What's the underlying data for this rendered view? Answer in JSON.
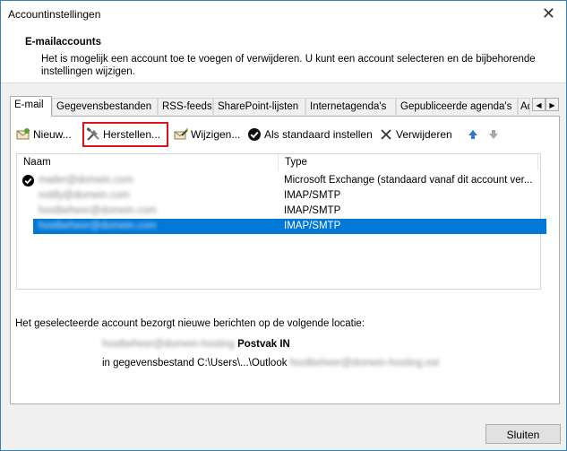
{
  "window": {
    "title": "Accountinstellingen",
    "close_glyph": "✕"
  },
  "header": {
    "title": "E-mailaccounts",
    "description": "Het is mogelijk een account toe te voegen of verwijderen. U kunt een account selecteren en de bijbehorende instellingen wijzigen."
  },
  "tabs": [
    "E-mail",
    "Gegevensbestanden",
    "RSS-feeds",
    "SharePoint-lijsten",
    "Internetagenda's",
    "Gepubliceerde agenda's",
    "Ad"
  ],
  "toolbar": {
    "new_label": "Nieuw...",
    "repair_label": "Herstellen...",
    "change_label": "Wijzigen...",
    "default_label": "Als standaard instellen",
    "remove_label": "Verwijderen"
  },
  "list": {
    "columns": [
      "Naam",
      "Type"
    ],
    "rows": [
      {
        "name": "mailer@domein.com",
        "type": "Microsoft Exchange (standaard vanaf dit account ver...",
        "default": true,
        "selected": false
      },
      {
        "name": "notify@domein.com",
        "type": "IMAP/SMTP",
        "default": false,
        "selected": false
      },
      {
        "name": "hostbeheer@domein.com",
        "type": "IMAP/SMTP",
        "default": false,
        "selected": false
      },
      {
        "name": "hostbeheer@domein.com",
        "type": "IMAP/SMTP",
        "default": false,
        "selected": true
      }
    ]
  },
  "delivery": {
    "label": "Het geselecteerde account bezorgt nieuwe berichten op de volgende locatie:",
    "account_blurred": "hostbeheer@domein-hosting",
    "folder": "Postvak IN",
    "datafile_prefix": "in gegevensbestand C:\\Users\\...\\Outlook",
    "datafile_blurred": "hostbeheer@domein-hosting.ost"
  },
  "footer": {
    "close_label": "Sluiten"
  },
  "colors": {
    "selection": "#0078d7",
    "highlight": "#e0131b"
  }
}
